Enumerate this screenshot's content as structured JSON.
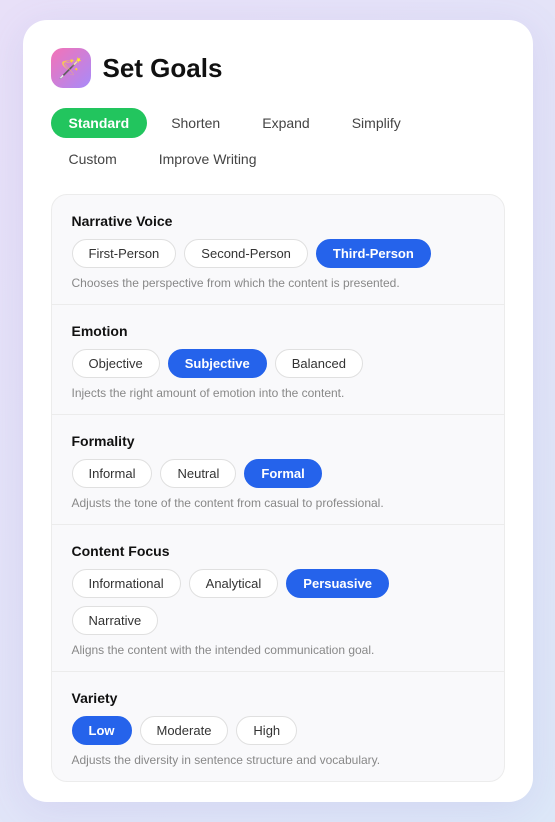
{
  "header": {
    "icon": "🪄",
    "title": "Set Goals"
  },
  "tabs": [
    {
      "id": "standard",
      "label": "Standard",
      "active": true
    },
    {
      "id": "shorten",
      "label": "Shorten",
      "active": false
    },
    {
      "id": "expand",
      "label": "Expand",
      "active": false
    },
    {
      "id": "simplify",
      "label": "Simplify",
      "active": false
    },
    {
      "id": "custom",
      "label": "Custom",
      "active": false
    },
    {
      "id": "improve-writing",
      "label": "Improve Writing",
      "active": false
    }
  ],
  "settings": [
    {
      "id": "narrative-voice",
      "label": "Narrative Voice",
      "options": [
        {
          "id": "first-person",
          "label": "First-Person",
          "selected": false
        },
        {
          "id": "second-person",
          "label": "Second-Person",
          "selected": false
        },
        {
          "id": "third-person",
          "label": "Third-Person",
          "selected": true
        }
      ],
      "description": "Chooses the perspective from which the content is presented."
    },
    {
      "id": "emotion",
      "label": "Emotion",
      "options": [
        {
          "id": "objective",
          "label": "Objective",
          "selected": false
        },
        {
          "id": "subjective",
          "label": "Subjective",
          "selected": true
        },
        {
          "id": "balanced",
          "label": "Balanced",
          "selected": false
        }
      ],
      "description": "Injects the right amount of emotion into the content."
    },
    {
      "id": "formality",
      "label": "Formality",
      "options": [
        {
          "id": "informal",
          "label": "Informal",
          "selected": false
        },
        {
          "id": "neutral",
          "label": "Neutral",
          "selected": false
        },
        {
          "id": "formal",
          "label": "Formal",
          "selected": true
        }
      ],
      "description": "Adjusts the tone of the content from casual to professional."
    },
    {
      "id": "content-focus",
      "label": "Content Focus",
      "options": [
        {
          "id": "informational",
          "label": "Informational",
          "selected": false
        },
        {
          "id": "analytical",
          "label": "Analytical",
          "selected": false
        },
        {
          "id": "persuasive",
          "label": "Persuasive",
          "selected": true
        },
        {
          "id": "narrative",
          "label": "Narrative",
          "selected": false
        }
      ],
      "description": "Aligns the content with the intended communication goal."
    },
    {
      "id": "variety",
      "label": "Variety",
      "options": [
        {
          "id": "low",
          "label": "Low",
          "selected": true
        },
        {
          "id": "moderate",
          "label": "Moderate",
          "selected": false
        },
        {
          "id": "high",
          "label": "High",
          "selected": false
        }
      ],
      "description": "Adjusts the diversity in sentence structure and vocabulary."
    }
  ]
}
